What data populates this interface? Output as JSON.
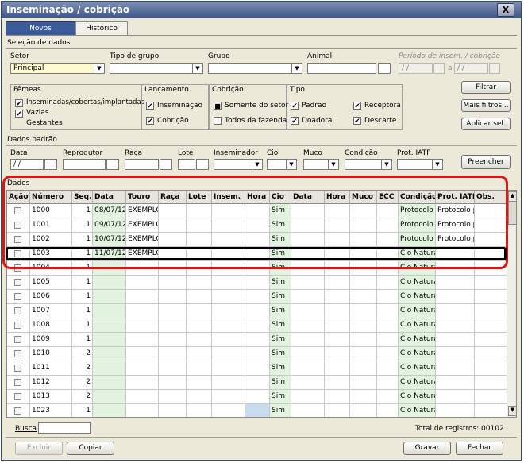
{
  "window": {
    "title": "Inseminação / cobrição",
    "close": "X"
  },
  "tabs": [
    {
      "label": "Novos lançamentos"
    },
    {
      "label": "Histórico"
    }
  ],
  "selecao": {
    "title": "Seleção de dados",
    "setor_label": "Setor",
    "setor_value": "Principal",
    "tipo_grupo_label": "Tipo de grupo",
    "grupo_label": "Grupo",
    "animal_label": "Animal",
    "periodo_label": "Período de insem. / cobrição",
    "periodo_from": "/ /",
    "periodo_a": "a",
    "periodo_to": "/ /",
    "femeas": {
      "title": "Fêmeas",
      "items": [
        {
          "label": "Inseminadas/cobertas/implantadas",
          "checked": true
        },
        {
          "label": "Vazias",
          "checked": true
        },
        {
          "label": "Gestantes",
          "checked": false
        }
      ]
    },
    "lancamento": {
      "title": "Lançamento",
      "items": [
        {
          "label": "Inseminação",
          "checked": true
        },
        {
          "label": "Cobrição",
          "checked": true
        }
      ]
    },
    "cobricao": {
      "title": "Cobrição",
      "items": [
        {
          "label": "Somente do setor",
          "checked": true
        },
        {
          "label": "Todos da fazenda",
          "checked": false
        }
      ]
    },
    "tipo": {
      "title": "Tipo",
      "items": [
        {
          "label": "Padrão",
          "checked": true
        },
        {
          "label": "Receptora",
          "checked": true
        },
        {
          "label": "Doadora",
          "checked": true
        },
        {
          "label": "Descarte",
          "checked": true
        }
      ]
    },
    "buttons": {
      "filtrar": "Filtrar",
      "mais_filtros": "Mais filtros...",
      "aplicar": "Aplicar sel."
    }
  },
  "padrao": {
    "title": "Dados padrão",
    "labels": {
      "data": "Data",
      "reprodutor": "Reprodutor",
      "raca": "Raça",
      "lote": "Lote",
      "inseminador": "Inseminador",
      "cio": "Cio",
      "muco": "Muco",
      "condicao": "Condição",
      "prot": "Prot. IATF"
    },
    "data_value": "/ /",
    "preencher": "Preencher"
  },
  "dados": {
    "title": "Dados",
    "columns": [
      "Ação",
      "Número",
      "Seq.",
      "Data",
      "Touro",
      "Raça",
      "Lote",
      "Insem.",
      "Hora",
      "Cio",
      "Data",
      "Hora",
      "Muco",
      "ECC",
      "Condição",
      "Prot. IATF",
      "Obs."
    ],
    "rows": [
      {
        "numero": "1000",
        "seq": "1",
        "data": "08/07/12",
        "touro": "EXEMPLO",
        "cio": "Sim",
        "condicao": "Protocolo IA",
        "prot": "Protocolo pa"
      },
      {
        "numero": "1001",
        "seq": "1",
        "data": "09/07/12",
        "touro": "EXEMPLO",
        "cio": "Sim",
        "condicao": "Protocolo IA",
        "prot": "Protocolo pa"
      },
      {
        "numero": "1002",
        "seq": "1",
        "data": "10/07/12",
        "touro": "EXEMPLO",
        "cio": "Sim",
        "condicao": "Protocolo IA",
        "prot": "Protocolo pa"
      },
      {
        "numero": "1003",
        "seq": "1",
        "data": "11/07/12",
        "touro": "EXEMPLO",
        "cio": "Sim",
        "condicao": "Cio Natural",
        "prot": ""
      },
      {
        "numero": "1004",
        "seq": "1",
        "data": "",
        "touro": "",
        "cio": "Sim",
        "condicao": "Cio Natural",
        "prot": ""
      },
      {
        "numero": "1005",
        "seq": "1",
        "data": "",
        "touro": "",
        "cio": "Sim",
        "condicao": "Cio Natural",
        "prot": ""
      },
      {
        "numero": "1006",
        "seq": "1",
        "data": "",
        "touro": "",
        "cio": "Sim",
        "condicao": "Cio Natural",
        "prot": ""
      },
      {
        "numero": "1007",
        "seq": "1",
        "data": "",
        "touro": "",
        "cio": "Sim",
        "condicao": "Cio Natural",
        "prot": ""
      },
      {
        "numero": "1008",
        "seq": "1",
        "data": "",
        "touro": "",
        "cio": "Sim",
        "condicao": "Cio Natural",
        "prot": ""
      },
      {
        "numero": "1009",
        "seq": "1",
        "data": "",
        "touro": "",
        "cio": "Sim",
        "condicao": "Cio Natural",
        "prot": ""
      },
      {
        "numero": "1010",
        "seq": "2",
        "data": "",
        "touro": "",
        "cio": "Sim",
        "condicao": "Cio Natural",
        "prot": ""
      },
      {
        "numero": "1011",
        "seq": "2",
        "data": "",
        "touro": "",
        "cio": "Sim",
        "condicao": "Cio Natural",
        "prot": ""
      },
      {
        "numero": "1012",
        "seq": "2",
        "data": "",
        "touro": "",
        "cio": "Sim",
        "condicao": "Cio Natural",
        "prot": ""
      },
      {
        "numero": "1013",
        "seq": "2",
        "data": "",
        "touro": "",
        "cio": "Sim",
        "condicao": "Cio Natural",
        "prot": ""
      },
      {
        "numero": "1023",
        "seq": "1",
        "data": "",
        "touro": "",
        "cio": "Sim",
        "condicao": "Cio Natural",
        "prot": ""
      }
    ]
  },
  "footer": {
    "busca_label": "Busca",
    "total": "Total de registros: 00102",
    "excluir": "Excluir",
    "copiar": "Copiar",
    "gravar": "Gravar",
    "fechar": "Fechar"
  },
  "colors": {
    "title_bar": "#3f5687",
    "active_tab": "#3b5b9b",
    "highlight_red": "#e01414",
    "editable_green": "#e2f4e0"
  }
}
